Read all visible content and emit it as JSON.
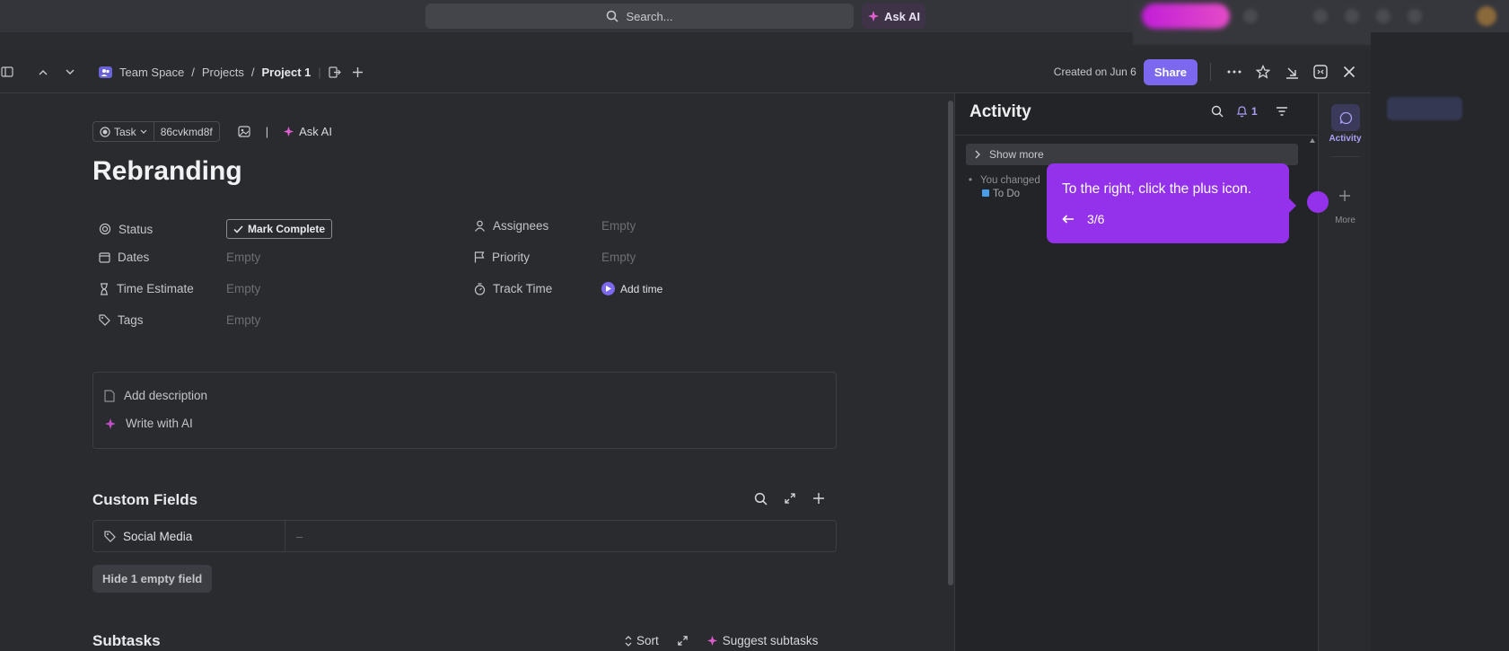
{
  "topbar": {
    "search_placeholder": "Search...",
    "ask_ai_label": "Ask AI"
  },
  "header": {
    "breadcrumbs": [
      "Team Space",
      "Projects",
      "Project 1"
    ],
    "created_text": "Created on Jun 6",
    "share_label": "Share"
  },
  "task": {
    "type_label": "Task",
    "task_id": "86cvkmd8f",
    "ask_ai_label": "Ask AI",
    "title": "Rebranding",
    "fields_left": [
      {
        "label": "Status",
        "value": "Mark Complete"
      },
      {
        "label": "Dates",
        "value": "Empty"
      },
      {
        "label": "Time Estimate",
        "value": "Empty"
      },
      {
        "label": "Tags",
        "value": "Empty"
      }
    ],
    "fields_right": [
      {
        "label": "Assignees",
        "value": "Empty"
      },
      {
        "label": "Priority",
        "value": "Empty"
      },
      {
        "label": "Track Time",
        "value": "Add time"
      }
    ],
    "add_description": "Add description",
    "write_with_ai": "Write with AI"
  },
  "custom_fields": {
    "title": "Custom Fields",
    "rows": [
      {
        "name": "Social Media",
        "value": "–"
      }
    ],
    "hide_button": "Hide 1 empty field"
  },
  "subtasks": {
    "title": "Subtasks",
    "sort_label": "Sort",
    "suggest_label": "Suggest subtasks"
  },
  "activity": {
    "title": "Activity",
    "notification_count": "1",
    "show_more": "Show more",
    "item_text": "You changed",
    "item_status": "To Do"
  },
  "rail": {
    "activity_label": "Activity",
    "more_label": "More"
  },
  "tooltip": {
    "text": "To the right, click the plus icon.",
    "step": "3/6"
  },
  "colors": {
    "accent": "#7b68ee",
    "tooltip": "#9332ea",
    "todo": "#4a9ce8"
  }
}
